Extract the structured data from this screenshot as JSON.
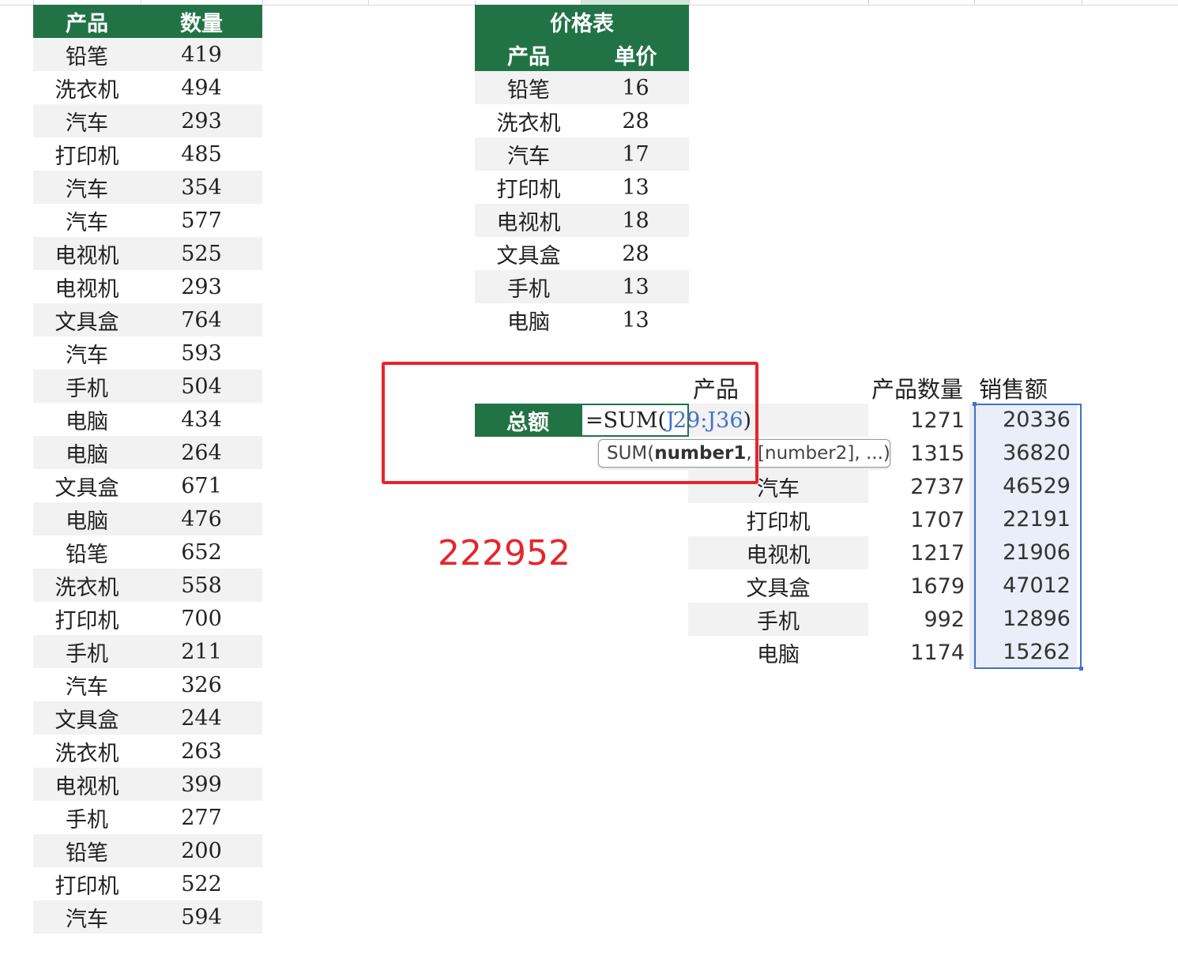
{
  "left_table": {
    "headers": [
      "产品",
      "数量"
    ],
    "rows": [
      [
        "铅笔",
        "419"
      ],
      [
        "洗衣机",
        "494"
      ],
      [
        "汽车",
        "293"
      ],
      [
        "打印机",
        "485"
      ],
      [
        "汽车",
        "354"
      ],
      [
        "汽车",
        "577"
      ],
      [
        "电视机",
        "525"
      ],
      [
        "电视机",
        "293"
      ],
      [
        "文具盒",
        "764"
      ],
      [
        "汽车",
        "593"
      ],
      [
        "手机",
        "504"
      ],
      [
        "电脑",
        "434"
      ],
      [
        "电脑",
        "264"
      ],
      [
        "文具盒",
        "671"
      ],
      [
        "电脑",
        "476"
      ],
      [
        "铅笔",
        "652"
      ],
      [
        "洗衣机",
        "558"
      ],
      [
        "打印机",
        "700"
      ],
      [
        "手机",
        "211"
      ],
      [
        "汽车",
        "326"
      ],
      [
        "文具盒",
        "244"
      ],
      [
        "洗衣机",
        "263"
      ],
      [
        "电视机",
        "399"
      ],
      [
        "手机",
        "277"
      ],
      [
        "铅笔",
        "200"
      ],
      [
        "打印机",
        "522"
      ],
      [
        "汽车",
        "594"
      ]
    ]
  },
  "price_table": {
    "title": "价格表",
    "headers": [
      "产品",
      "单价"
    ],
    "rows": [
      [
        "铅笔",
        "16"
      ],
      [
        "洗衣机",
        "28"
      ],
      [
        "汽车",
        "17"
      ],
      [
        "打印机",
        "13"
      ],
      [
        "电视机",
        "18"
      ],
      [
        "文具盒",
        "28"
      ],
      [
        "手机",
        "13"
      ],
      [
        "电脑",
        "13"
      ]
    ]
  },
  "summary_table": {
    "headers": [
      "产品",
      "产品数量",
      "销售额"
    ],
    "rows": [
      [
        "",
        "1271",
        "20336"
      ],
      [
        "",
        "1315",
        "36820"
      ],
      [
        "汽车",
        "2737",
        "46529"
      ],
      [
        "打印机",
        "1707",
        "22191"
      ],
      [
        "电视机",
        "1217",
        "21906"
      ],
      [
        "文具盒",
        "1679",
        "47012"
      ],
      [
        "手机",
        "992",
        "12896"
      ],
      [
        "电脑",
        "1174",
        "15262"
      ]
    ]
  },
  "total": {
    "label": "总额",
    "formula_prefix": "=SUM(",
    "ref_a": "J",
    "ref_b": "29:J36",
    "formula_suffix": ")"
  },
  "tooltip": {
    "func": "SUM(",
    "arg_bold": "number1",
    "rest": ", [number2], ...)"
  },
  "result_value": "222952",
  "colors": {
    "header_green": "#217346",
    "highlight_red": "#e8242a",
    "selection_blue": "#4472c4"
  }
}
